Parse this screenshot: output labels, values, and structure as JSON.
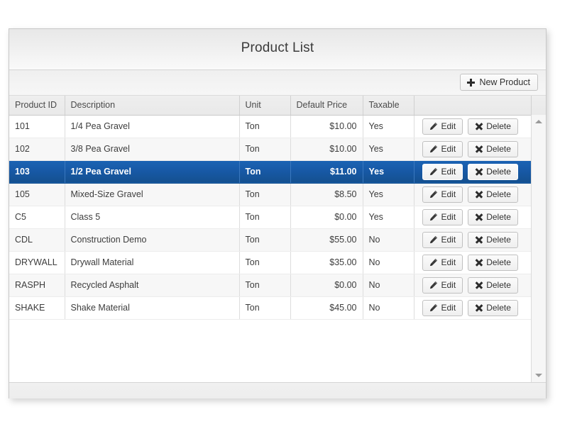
{
  "panel": {
    "title": "Product List"
  },
  "toolbar": {
    "new_product_label": "New Product",
    "new_product_icon": "plus-icon"
  },
  "grid": {
    "columns": [
      {
        "key": "product_id",
        "label": "Product ID",
        "align": "left"
      },
      {
        "key": "description",
        "label": "Description",
        "align": "left"
      },
      {
        "key": "unit",
        "label": "Unit",
        "align": "left"
      },
      {
        "key": "default_price",
        "label": "Default Price",
        "align": "right"
      },
      {
        "key": "taxable",
        "label": "Taxable",
        "align": "left"
      },
      {
        "key": "actions",
        "label": "",
        "align": "left"
      },
      {
        "key": "scrollgutter",
        "label": "",
        "align": "left"
      }
    ],
    "row_actions": {
      "edit_label": "Edit",
      "edit_icon": "pencil-icon",
      "delete_label": "Delete",
      "delete_icon": "x-icon"
    },
    "selected_row_index": 2,
    "selection_color": "#1758a4",
    "rows": [
      {
        "product_id": "101",
        "description": "1/4 Pea Gravel",
        "unit": "Ton",
        "default_price": "$10.00",
        "taxable": "Yes"
      },
      {
        "product_id": "102",
        "description": "3/8 Pea Gravel",
        "unit": "Ton",
        "default_price": "$10.00",
        "taxable": "Yes"
      },
      {
        "product_id": "103",
        "description": "1/2 Pea Gravel",
        "unit": "Ton",
        "default_price": "$11.00",
        "taxable": "Yes"
      },
      {
        "product_id": "105",
        "description": "Mixed-Size Gravel",
        "unit": "Ton",
        "default_price": "$8.50",
        "taxable": "Yes"
      },
      {
        "product_id": "C5",
        "description": "Class 5",
        "unit": "Ton",
        "default_price": "$0.00",
        "taxable": "Yes"
      },
      {
        "product_id": "CDL",
        "description": "Construction Demo",
        "unit": "Ton",
        "default_price": "$55.00",
        "taxable": "No"
      },
      {
        "product_id": "DRYWALL",
        "description": "Drywall Material",
        "unit": "Ton",
        "default_price": "$35.00",
        "taxable": "No"
      },
      {
        "product_id": "RASPH",
        "description": "Recycled Asphalt",
        "unit": "Ton",
        "default_price": "$0.00",
        "taxable": "No"
      },
      {
        "product_id": "SHAKE",
        "description": "Shake Material",
        "unit": "Ton",
        "default_price": "$45.00",
        "taxable": "No"
      }
    ]
  },
  "scrollbar": {
    "up_arrow_icon": "triangle-up-icon",
    "down_arrow_icon": "triangle-down-icon"
  }
}
